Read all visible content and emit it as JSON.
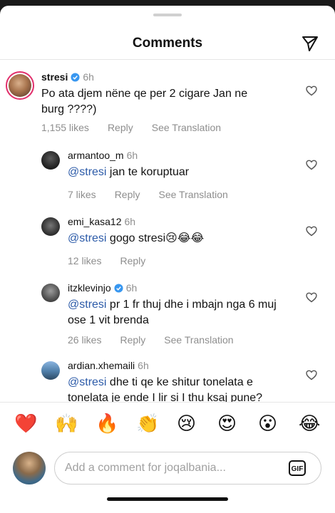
{
  "header": {
    "title": "Comments"
  },
  "comments": [
    {
      "username": "stresi",
      "time": "6h",
      "verified": true,
      "mention": "",
      "text": "Po ata djem nëne qe per 2 cigare Jan ne burg ????)",
      "likes": "1,155 likes",
      "reply": "Reply",
      "translation": "See Translation"
    },
    {
      "username": "armantoo_m",
      "time": "6h",
      "verified": false,
      "mention": "@stresi",
      "text": " jan te koruptuar",
      "likes": "7 likes",
      "reply": "Reply",
      "translation": "See Translation"
    },
    {
      "username": "emi_kasa12",
      "time": "6h",
      "verified": false,
      "mention": "@stresi",
      "text": " gogo stresi😢😂😂",
      "likes": "12 likes",
      "reply": "Reply",
      "translation": ""
    },
    {
      "username": "itzklevinjo",
      "time": "6h",
      "verified": true,
      "mention": "@stresi",
      "text": " pr 1 fr thuj dhe i mbajn nga 6 muj ose 1 vit brenda",
      "likes": "26 likes",
      "reply": "Reply",
      "translation": "See Translation"
    },
    {
      "username": "ardian.xhemaili",
      "time": "6h",
      "verified": false,
      "mention": "@stresi",
      "text": " dhe ti qe ke shitur tonelata e tonelata je ende I lir si I thu ksaj pune?",
      "likes": "",
      "reply": "",
      "translation": ""
    }
  ],
  "emoji_bar": [
    "❤️",
    "🙌",
    "🔥",
    "👏",
    "😢",
    "😍",
    "😮",
    "😂"
  ],
  "composer": {
    "placeholder": "Add a comment for joqalbania...",
    "gif_label": "GIF"
  },
  "colors": {
    "mention": "#2b5aa8",
    "verified": "#3897f0",
    "meta_gray": "#8e8e8e"
  }
}
